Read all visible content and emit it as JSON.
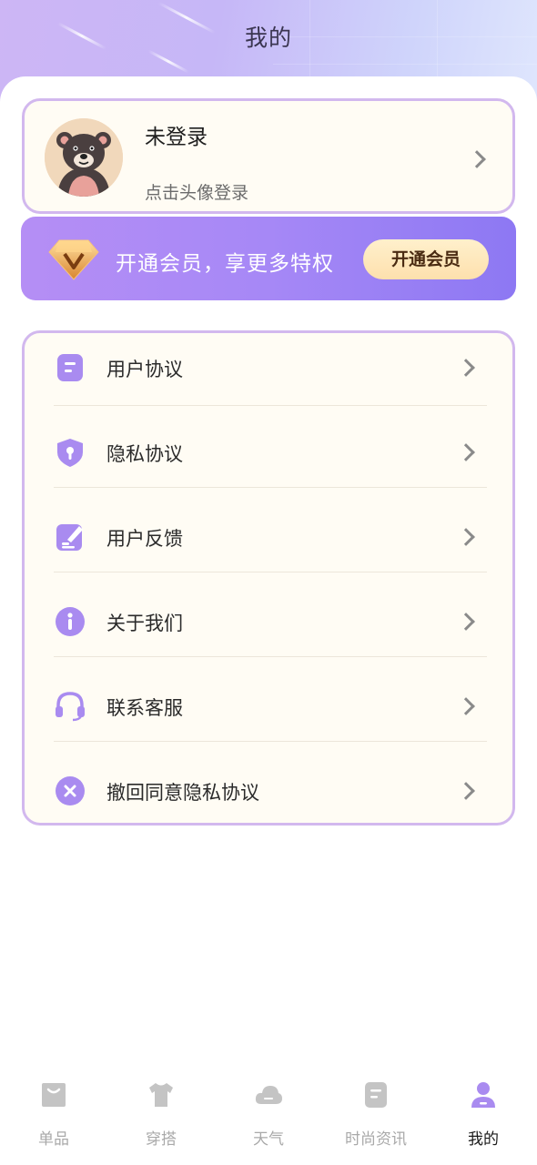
{
  "header": {
    "title": "我的"
  },
  "profile": {
    "name": "未登录",
    "hint": "点击头像登录"
  },
  "vip": {
    "text": "开通会员，享更多特权",
    "button_label": "开通会员"
  },
  "menu": {
    "items": [
      {
        "label": "用户协议",
        "icon": "document-icon"
      },
      {
        "label": "隐私协议",
        "icon": "shield-icon"
      },
      {
        "label": "用户反馈",
        "icon": "feedback-edit-icon"
      },
      {
        "label": "关于我们",
        "icon": "info-icon"
      },
      {
        "label": "联系客服",
        "icon": "headset-icon"
      },
      {
        "label": "撤回同意隐私协议",
        "icon": "close-circle-icon"
      }
    ]
  },
  "tabbar": {
    "tabs": [
      {
        "label": "单品",
        "icon": "bag-icon",
        "active": false
      },
      {
        "label": "穿搭",
        "icon": "shirt-icon",
        "active": false
      },
      {
        "label": "天气",
        "icon": "cloud-icon",
        "active": false
      },
      {
        "label": "时尚资讯",
        "icon": "news-icon",
        "active": false
      },
      {
        "label": "我的",
        "icon": "person-icon",
        "active": true
      }
    ]
  },
  "colors": {
    "accent": "#a98bf0",
    "card_border": "#d2b8ee",
    "card_bg": "#fffcf4",
    "inactive_tab": "#c4c4c4"
  }
}
